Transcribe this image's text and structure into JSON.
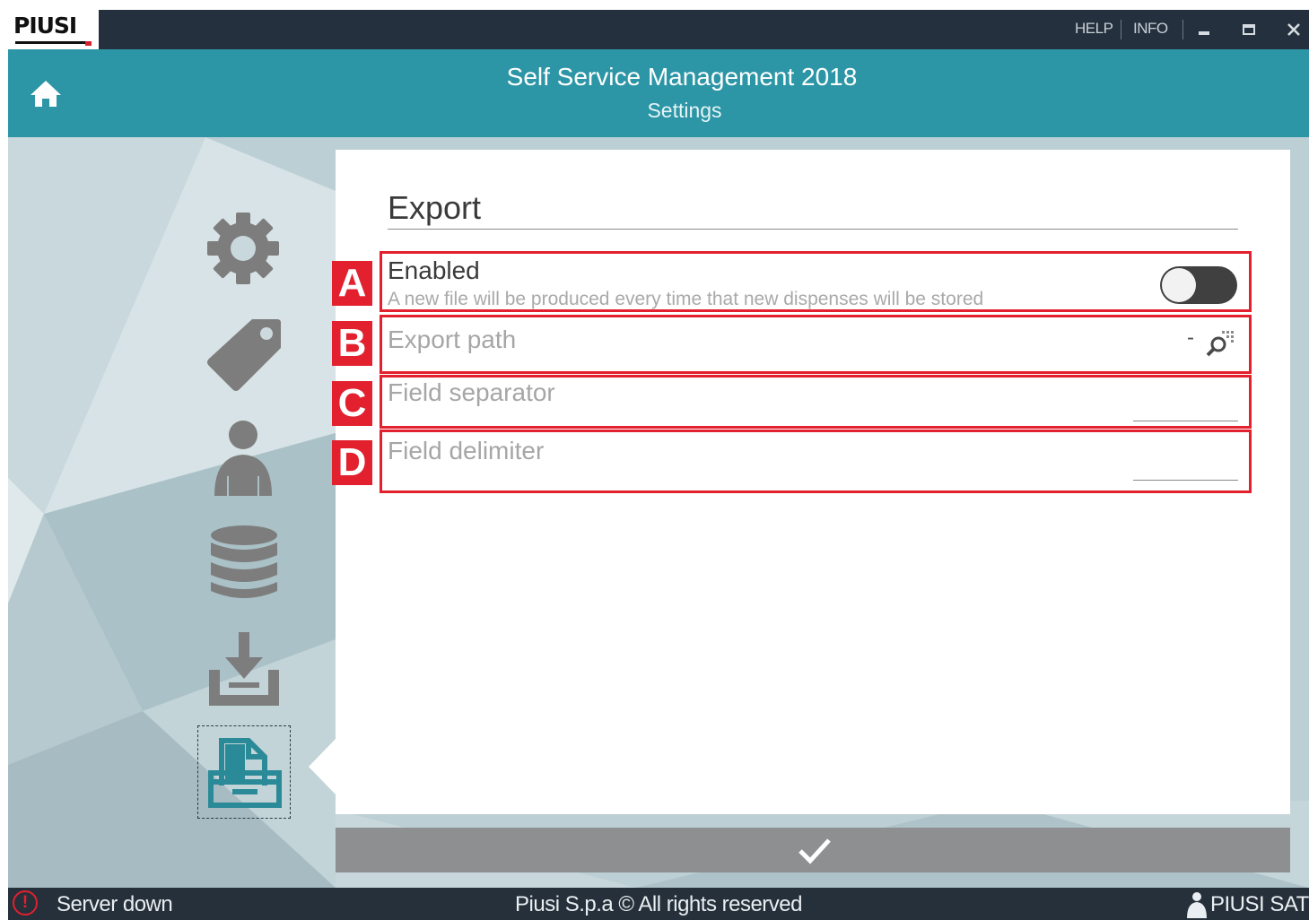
{
  "titlebar": {
    "logo_text": "PIUSI",
    "help": "HELP",
    "info": "INFO",
    "minimize": "▂",
    "maximize": "▭",
    "close": "✕"
  },
  "header": {
    "title": "Self Service Management 2018",
    "subtitle": "Settings"
  },
  "nav": {
    "items": [
      {
        "icon": "gear-icon"
      },
      {
        "icon": "tag-icon"
      },
      {
        "icon": "user-icon"
      },
      {
        "icon": "database-icon"
      },
      {
        "icon": "download-icon"
      },
      {
        "icon": "export-printer-icon",
        "active": true
      }
    ]
  },
  "export": {
    "section_title": "Export",
    "enabled": {
      "badge": "A",
      "label": "Enabled",
      "description": "A new file will be produced every time that new dispenses will be stored",
      "on": false
    },
    "export_path": {
      "badge": "B",
      "label": "Export path",
      "value": "-"
    },
    "field_separator": {
      "badge": "C",
      "label": "Field separator",
      "value": ""
    },
    "field_delimiter": {
      "badge": "D",
      "label": "Field delimiter",
      "value": ""
    }
  },
  "confirm": {
    "icon": "check-icon"
  },
  "statusbar": {
    "alert_symbol": "!",
    "server_status": "Server down",
    "copyright": "Piusi S.p.a © All rights reserved",
    "user": "PIUSI SAT"
  },
  "colors": {
    "header": "#2c96a6",
    "titlebar": "#24303d",
    "accent_teal": "#2b8a97",
    "annotation_red": "#e2202e",
    "icon_gray": "#7d7d7d"
  }
}
